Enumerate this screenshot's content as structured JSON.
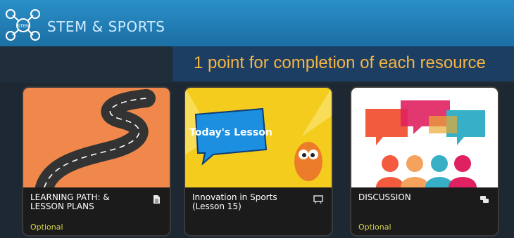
{
  "header": {
    "title": "STEM & SPORTS",
    "logo_text": "STEM"
  },
  "banner": {
    "text": "1 point for completion of each resource"
  },
  "cards": [
    {
      "title": "LEARNING PATH: & LESSON PLANS",
      "tag": "Optional",
      "icon": "document-icon"
    },
    {
      "title": "Innovation in Sports (Lesson 15)",
      "tag": "",
      "icon": "presentation-icon",
      "image_text": "Today's Lesson"
    },
    {
      "title": "DISCUSSION",
      "tag": "Optional",
      "icon": "chat-bubbles-icon"
    }
  ]
}
